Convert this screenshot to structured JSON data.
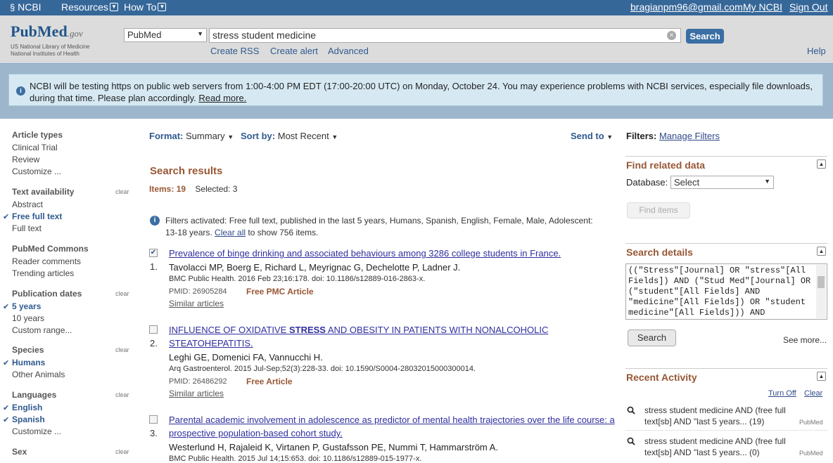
{
  "topbar": {
    "ncbi": "NCBI",
    "resources": "Resources",
    "howto": "How To",
    "email": "bragianpm96@gmail.com",
    "myncbi": "My NCBI",
    "signout": "Sign Out"
  },
  "header": {
    "logo_pub": "Pub",
    "logo_med": "Med",
    "logo_gov": ".gov",
    "logo_line1": "US National Library of Medicine",
    "logo_line2": "National Institutes of Health",
    "db_value": "PubMed",
    "query": "stress student medicine",
    "search_label": "Search",
    "create_rss": "Create RSS",
    "create_alert": "Create alert",
    "advanced": "Advanced",
    "help": "Help"
  },
  "notice": {
    "text": "NCBI will be testing https on public web servers from 1:00-4:00 PM EDT (17:00-20:00 UTC) on Monday, October 24. You may experience problems with NCBI services, especially file downloads, during that time. Please plan accordingly.",
    "link": "Read more."
  },
  "sidebar": {
    "clear": "clear",
    "sections": [
      {
        "title": "Article types",
        "items": [
          {
            "label": "Clinical Trial"
          },
          {
            "label": "Review"
          },
          {
            "label": "Customize ..."
          }
        ]
      },
      {
        "title": "Text availability",
        "items": [
          {
            "label": "Abstract"
          },
          {
            "label": "Free full text",
            "checked": true
          },
          {
            "label": "Full text"
          }
        ]
      },
      {
        "title": "PubMed Commons",
        "items": [
          {
            "label": "Reader comments"
          },
          {
            "label": "Trending articles"
          }
        ]
      },
      {
        "title": "Publication dates",
        "items": [
          {
            "label": "5 years",
            "checked": true
          },
          {
            "label": "10 years"
          },
          {
            "label": "Custom range..."
          }
        ]
      },
      {
        "title": "Species",
        "items": [
          {
            "label": "Humans",
            "checked": true
          },
          {
            "label": "Other Animals"
          }
        ]
      },
      {
        "title": "Languages",
        "items": [
          {
            "label": "English",
            "checked": true
          },
          {
            "label": "Spanish",
            "checked": true
          },
          {
            "label": "Customize ..."
          }
        ]
      },
      {
        "title": "Sex",
        "items": []
      }
    ]
  },
  "toolbar": {
    "format_label": "Format:",
    "format_value": "Summary",
    "sort_label": "Sort by:",
    "sort_value": "Most Recent",
    "send_to": "Send to"
  },
  "results": {
    "heading": "Search results",
    "items_label": "Items:",
    "items_count": "19",
    "selected_label": "Selected:",
    "selected_count": "3",
    "filters_text": "Filters activated: Free full text, published in the last 5 years, Humans, Spanish, English, Female, Male, Adolescent: 13-18 years.",
    "clear_all": "Clear all",
    "filters_tail": "to show 756 items.",
    "list": [
      {
        "num": "1.",
        "checked": true,
        "title": "Prevalence of binge drinking and associated behaviours among 3286 college students in France.",
        "authors": "Tavolacci MP, Boerg E, Richard L, Meyrignac G, Dechelotte P, Ladner J.",
        "journal": "BMC Public Health. 2016 Feb 23;16:178. doi: 10.1186/s12889-016-2863-x.",
        "pmid": "PMID: 26905284",
        "free": "Free PMC Article",
        "similar": "Similar articles"
      },
      {
        "num": "2.",
        "checked": false,
        "title_a": "INFLUENCE OF OXIDATIVE ",
        "title_b": "STRESS",
        "title_c": " AND OBESITY IN PATIENTS WITH NONALCOHOLIC STEATOHEPATITIS.",
        "authors": "Leghi GE, Domenici FA, Vannucchi H.",
        "journal": "Arq Gastroenterol. 2015 Jul-Sep;52(3):228-33. doi: 10.1590/S0004-28032015000300014.",
        "pmid": "PMID: 26486292",
        "free": "Free Article",
        "similar": "Similar articles"
      },
      {
        "num": "3.",
        "checked": false,
        "title": "Parental academic involvement in adolescence as predictor of mental health trajectories over the life course: a prospective population-based cohort study.",
        "authors": "Westerlund H, Rajaleid K, Virtanen P, Gustafsson PE, Nummi T, Hammarström A.",
        "journal": "BMC Public Health. 2015 Jul 14;15:653. doi: 10.1186/s12889-015-1977-x."
      }
    ]
  },
  "right": {
    "filters_label": "Filters:",
    "manage_filters": "Manage Filters",
    "related_title": "Find related data",
    "database_label": "Database:",
    "database_value": "Select",
    "find_items": "Find items",
    "details_title": "Search details",
    "details_text": "((\"Stress\"[Journal] OR \"stress\"[All Fields]) AND (\"Stud Med\"[Journal] OR (\"student\"[All Fields] AND \"medicine\"[All Fields]) OR \"student medicine\"[All Fields])) AND",
    "details_search": "Search",
    "see_more": "See more...",
    "recent_title": "Recent Activity",
    "turn_off": "Turn Off",
    "clear": "Clear",
    "recent": [
      {
        "text": "stress student medicine AND (free full text[sb] AND \"last 5 years... (19)",
        "db": "PubMed"
      },
      {
        "text": "stress student medicine AND (free full text[sb] AND \"last 5 years... (0)",
        "db": "PubMed"
      }
    ]
  }
}
